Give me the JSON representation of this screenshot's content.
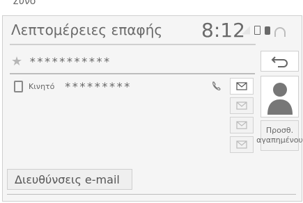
{
  "header": {
    "title": "Λεπτομέρειες επαφής",
    "clock": "8:12"
  },
  "top_fragment": {
    "text": "Συνο"
  },
  "contact": {
    "name": "***********",
    "mobile_label": "Κινητό",
    "mobile_number": "*********"
  },
  "buttons": {
    "fav_line1": "Προσθ.",
    "fav_line2": "αγαπημένου",
    "email_addresses": "Διευθύνσεις e-mail"
  },
  "icons": {
    "star": "star-icon",
    "back": "back-arrow-icon",
    "mobile": "mobile-phone-icon",
    "call": "phone-call-icon",
    "mail": "envelope-icon",
    "photo": "person-silhouette-icon",
    "bluetooth": "bluetooth-icon",
    "sim": "sim-icon",
    "wifi": "wifi-icon",
    "signal": "signal-strength-icon"
  }
}
